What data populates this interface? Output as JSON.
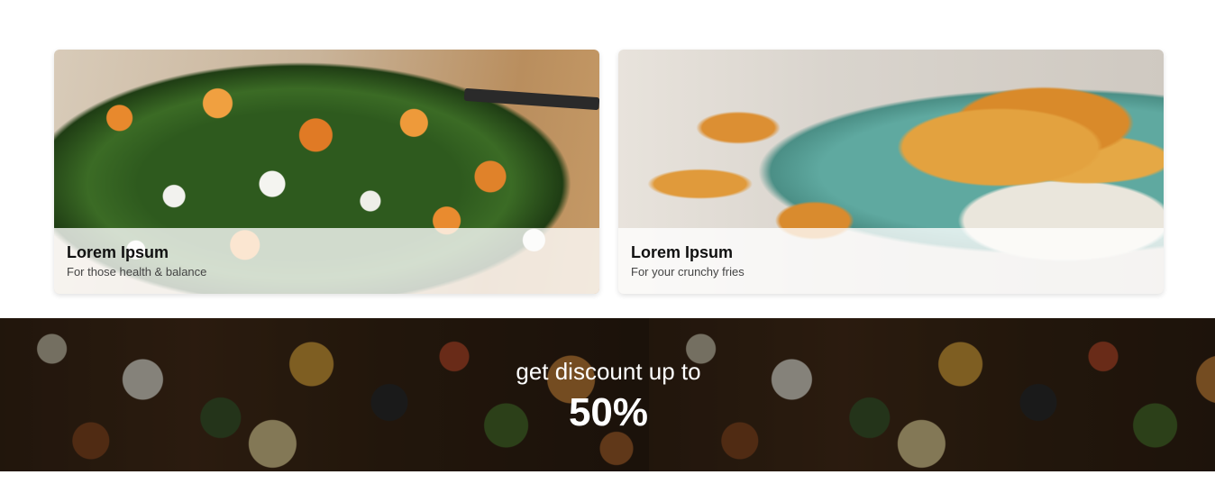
{
  "cards": [
    {
      "title": "Lorem Ipsum",
      "subtitle": "For those health & balance",
      "image": "salad-photo"
    },
    {
      "title": "Lorem Ipsum",
      "subtitle": "For your crunchy fries",
      "image": "fries-photo"
    }
  ],
  "banner": {
    "line1": "get discount up to",
    "line2": "50%",
    "image": "food-table-photo"
  },
  "colors": {
    "overlay": "#ffffff",
    "title": "#111111",
    "subtitle": "#444444",
    "banner_text": "#ffffff"
  }
}
